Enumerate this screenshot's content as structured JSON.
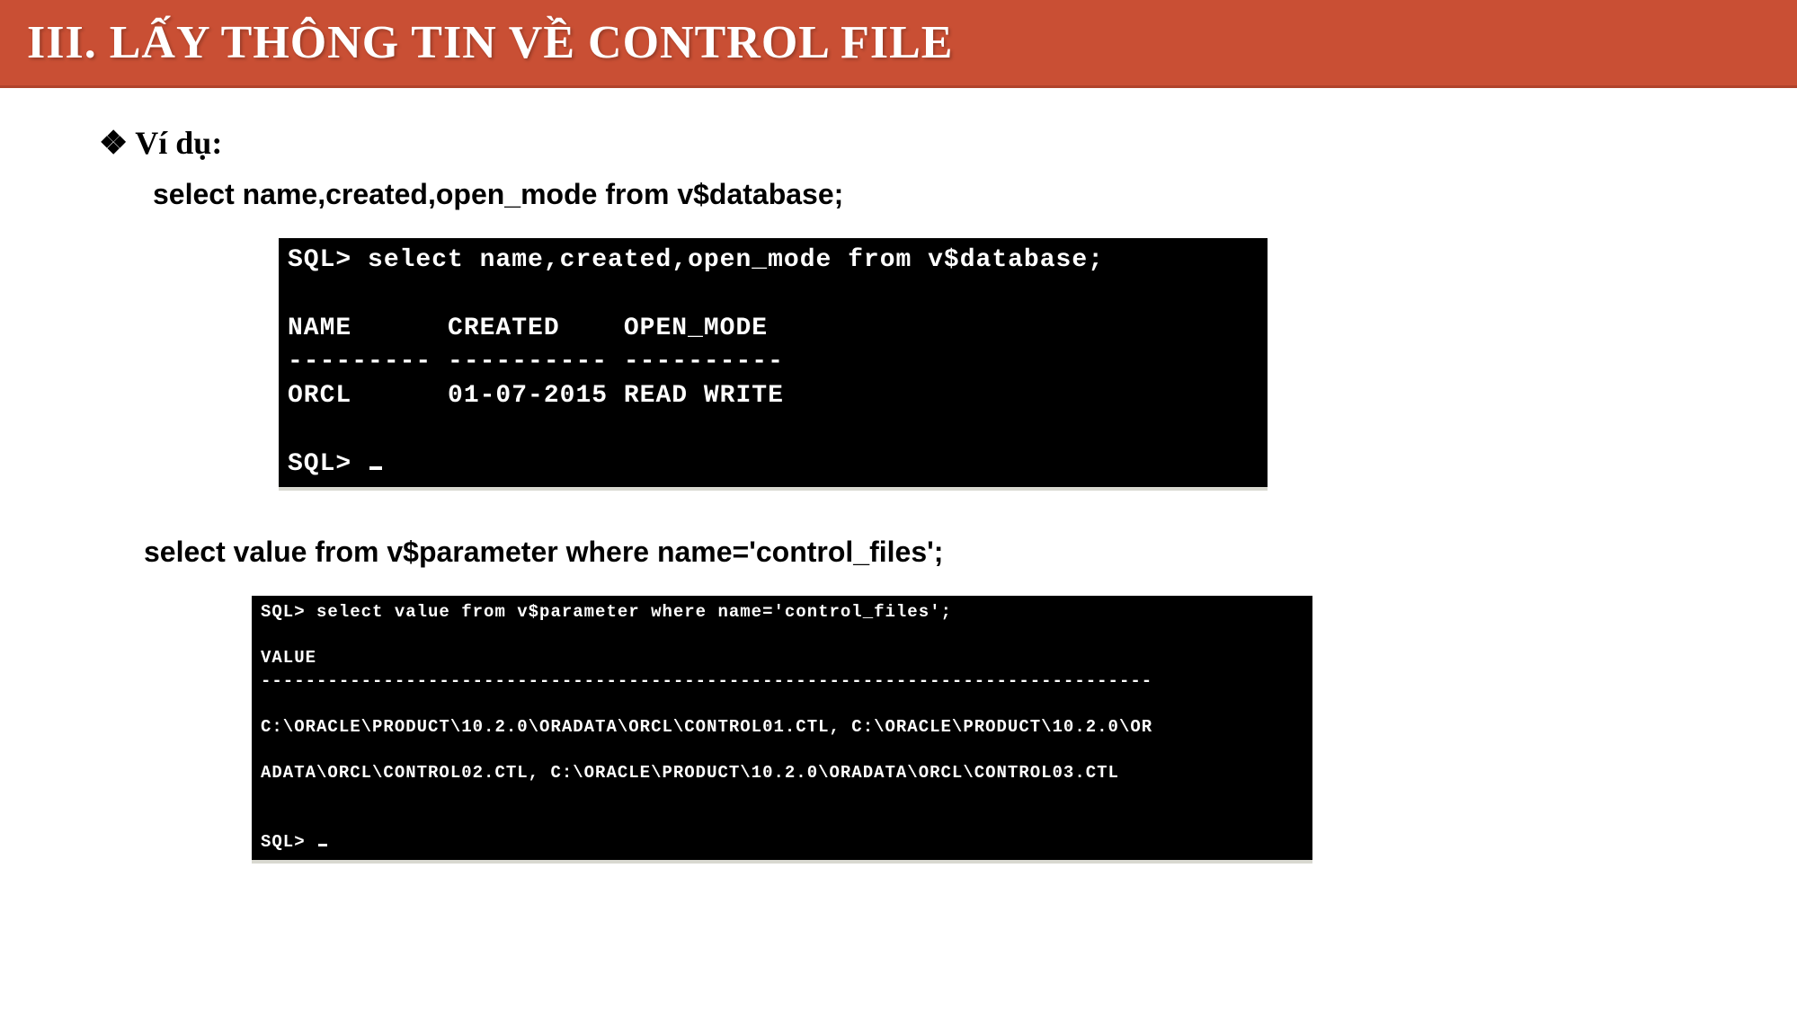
{
  "title": "III. LẤY THÔNG TIN VỀ CONTROL FILE",
  "example_label": "Ví dụ:",
  "bullet": "❖",
  "sql1_text": "select name,created,open_mode from v$database;",
  "sql2_text": "select value from v$parameter where name='control_files';",
  "terminal1": {
    "line1": "SQL> select name,created,open_mode from v$database;",
    "line2": "",
    "line3": "NAME      CREATED    OPEN_MODE",
    "line4": "--------- ---------- ----------",
    "line5": "ORCL      01-07-2015 READ WRITE",
    "line6": "",
    "line7": "SQL> "
  },
  "terminal2": {
    "line1": "SQL> select value from v$parameter where name='control_files';",
    "line2": "",
    "line3": "VALUE",
    "line4": "--------------------------------------------------------------------------------",
    "line5": "",
    "line6": "C:\\ORACLE\\PRODUCT\\10.2.0\\ORADATA\\ORCL\\CONTROL01.CTL, C:\\ORACLE\\PRODUCT\\10.2.0\\OR",
    "line7": "",
    "line8": "ADATA\\ORCL\\CONTROL02.CTL, C:\\ORACLE\\PRODUCT\\10.2.0\\ORADATA\\ORCL\\CONTROL03.CTL",
    "line9": "",
    "line10": "",
    "line11": "SQL> "
  }
}
